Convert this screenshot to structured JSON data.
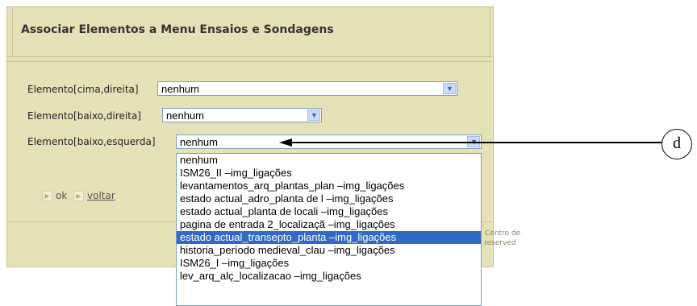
{
  "panel": {
    "title": "Associar Elementos a Menu Ensaios e Sondagens"
  },
  "form": {
    "fields": [
      {
        "label": "Elemento[cima,direita]",
        "value": "nenhum"
      },
      {
        "label": "Elemento[baixo,direita]",
        "value": "nenhum"
      },
      {
        "label": "Elemento[baixo,esquerda]",
        "value": "nenhum"
      }
    ],
    "dropdown_options": [
      "nenhum",
      "ISM26_II –img_ligações",
      "levantamentos_arq_plantas_plan –img_ligações",
      "estado actual_adro_planta de l –img_ligações",
      "estado actual_planta de locali –img_ligações",
      "pagina de entrada 2_localizaçã –img_ligações",
      "estado actual_transepto_planta –img_ligações",
      "historia_período medieval_clau –img_ligações",
      "ISM26_I –img_ligações",
      "lev_arq_alç_localizacao –img_ligações"
    ],
    "highlighted_option_index": 6
  },
  "buttons": {
    "ok": "ok",
    "voltar": "voltar"
  },
  "footer": {
    "line1": "Centro de",
    "line2": "reserved"
  },
  "annotation": {
    "callout_label": "d"
  },
  "colors": {
    "panel_bg": "#e6e2b8",
    "highlight": "#316ac5"
  }
}
